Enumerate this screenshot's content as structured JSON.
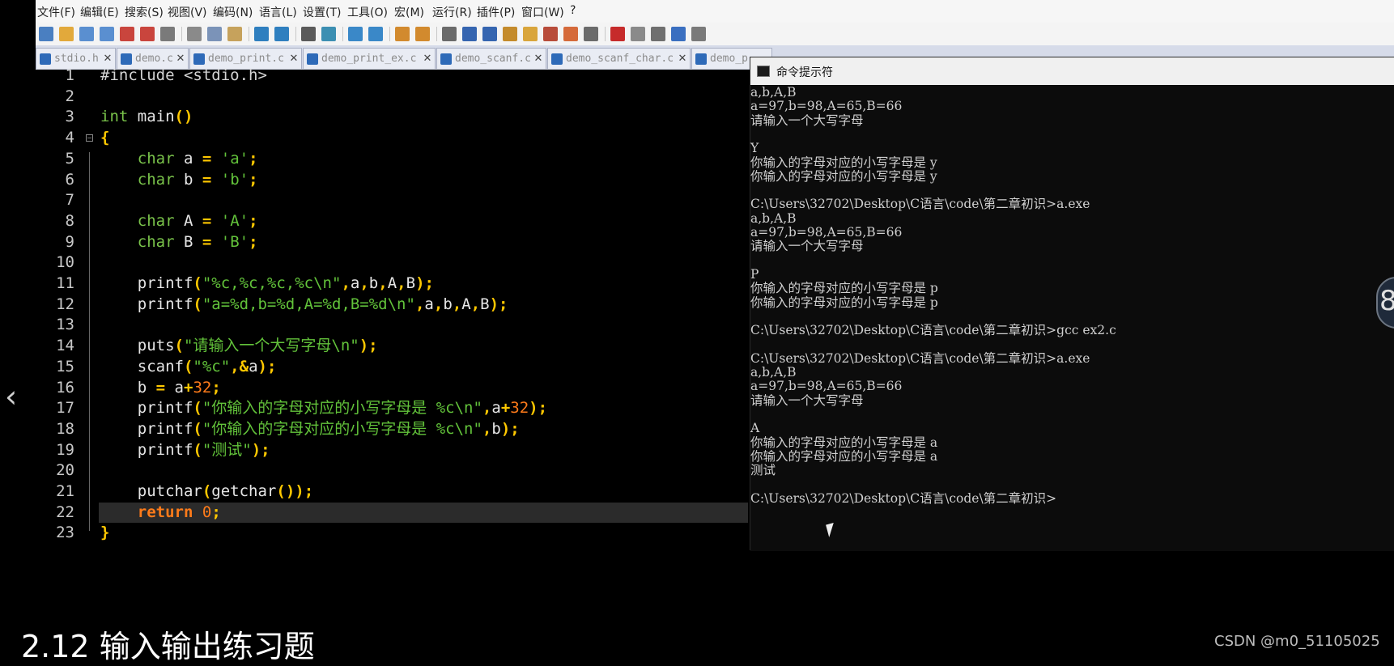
{
  "menubar": {
    "items": [
      "文件(F)",
      "编辑(E)",
      "搜索(S)",
      "视图(V)",
      "编码(N)",
      "语言(L)",
      "设置(T)",
      "工具(O)",
      "宏(M)",
      "运行(R)",
      "插件(P)",
      "窗口(W)",
      "?"
    ]
  },
  "toolbar": {
    "icons": [
      "new-file-icon",
      "open-file-icon",
      "save-icon",
      "save-all-icon",
      "close-icon",
      "close-all-icon",
      "print-icon",
      "cut-icon",
      "copy-icon",
      "paste-icon",
      "undo-icon",
      "redo-icon",
      "find-icon",
      "replace-icon",
      "zoom-in-icon",
      "zoom-out-icon",
      "sync-vertical-icon",
      "sync-horizontal-icon",
      "word-wrap-icon",
      "show-all-chars-icon",
      "indent-guide-icon",
      "document-map-icon",
      "function-list-icon",
      "doc-switcher-icon",
      "folder-workspace-icon",
      "monitoring-icon",
      "record-macro-icon",
      "stop-macro-icon",
      "play-macro-icon",
      "run-macro-multiple-icon",
      "save-macro-icon"
    ]
  },
  "tabs": [
    {
      "label": "stdio.h",
      "icon": "file-icon"
    },
    {
      "label": "demo.c",
      "icon": "file-icon"
    },
    {
      "label": "demo_print.c",
      "icon": "file-icon"
    },
    {
      "label": "demo_print_ex.c",
      "icon": "file-icon"
    },
    {
      "label": "demo_scanf.c",
      "icon": "file-icon"
    },
    {
      "label": "demo_scanf_char.c",
      "icon": "file-icon"
    },
    {
      "label": "demo_p",
      "icon": "file-icon"
    }
  ],
  "editor": {
    "line_numbers": [
      "1",
      "2",
      "3",
      "4",
      "5",
      "6",
      "7",
      "8",
      "9",
      "10",
      "11",
      "12",
      "13",
      "14",
      "15",
      "16",
      "17",
      "18",
      "19",
      "20",
      "21",
      "22",
      "23"
    ],
    "fold_glyph": "−",
    "lines": [
      [
        {
          "t": "#include <stdio.h>",
          "c": "pp"
        }
      ],
      [],
      [
        {
          "t": "int",
          "c": "type"
        },
        {
          "t": " main",
          "c": "id"
        },
        {
          "t": "()",
          "c": "op"
        }
      ],
      [
        {
          "t": "{",
          "c": "op"
        }
      ],
      [
        {
          "t": "    ",
          "c": "id"
        },
        {
          "t": "char",
          "c": "type"
        },
        {
          "t": " a ",
          "c": "id"
        },
        {
          "t": "=",
          "c": "op"
        },
        {
          "t": " ",
          "c": "id"
        },
        {
          "t": "'a'",
          "c": "str"
        },
        {
          "t": ";",
          "c": "op"
        }
      ],
      [
        {
          "t": "    ",
          "c": "id"
        },
        {
          "t": "char",
          "c": "type"
        },
        {
          "t": " b ",
          "c": "id"
        },
        {
          "t": "=",
          "c": "op"
        },
        {
          "t": " ",
          "c": "id"
        },
        {
          "t": "'b'",
          "c": "str"
        },
        {
          "t": ";",
          "c": "op"
        }
      ],
      [],
      [
        {
          "t": "    ",
          "c": "id"
        },
        {
          "t": "char",
          "c": "type"
        },
        {
          "t": " A ",
          "c": "id"
        },
        {
          "t": "=",
          "c": "op"
        },
        {
          "t": " ",
          "c": "id"
        },
        {
          "t": "'A'",
          "c": "str"
        },
        {
          "t": ";",
          "c": "op"
        }
      ],
      [
        {
          "t": "    ",
          "c": "id"
        },
        {
          "t": "char",
          "c": "type"
        },
        {
          "t": " B ",
          "c": "id"
        },
        {
          "t": "=",
          "c": "op"
        },
        {
          "t": " ",
          "c": "id"
        },
        {
          "t": "'B'",
          "c": "str"
        },
        {
          "t": ";",
          "c": "op"
        }
      ],
      [],
      [
        {
          "t": "    printf",
          "c": "id"
        },
        {
          "t": "(",
          "c": "op"
        },
        {
          "t": "\"%c,%c,%c,%c\\n\"",
          "c": "str"
        },
        {
          "t": ",",
          "c": "op"
        },
        {
          "t": "a",
          "c": "id"
        },
        {
          "t": ",",
          "c": "op"
        },
        {
          "t": "b",
          "c": "id"
        },
        {
          "t": ",",
          "c": "op"
        },
        {
          "t": "A",
          "c": "id"
        },
        {
          "t": ",",
          "c": "op"
        },
        {
          "t": "B",
          "c": "id"
        },
        {
          "t": ");",
          "c": "op"
        }
      ],
      [
        {
          "t": "    printf",
          "c": "id"
        },
        {
          "t": "(",
          "c": "op"
        },
        {
          "t": "\"a=%d,b=%d,A=%d,B=%d\\n\"",
          "c": "str"
        },
        {
          "t": ",",
          "c": "op"
        },
        {
          "t": "a",
          "c": "id"
        },
        {
          "t": ",",
          "c": "op"
        },
        {
          "t": "b",
          "c": "id"
        },
        {
          "t": ",",
          "c": "op"
        },
        {
          "t": "A",
          "c": "id"
        },
        {
          "t": ",",
          "c": "op"
        },
        {
          "t": "B",
          "c": "id"
        },
        {
          "t": ");",
          "c": "op"
        }
      ],
      [],
      [
        {
          "t": "    puts",
          "c": "id"
        },
        {
          "t": "(",
          "c": "op"
        },
        {
          "t": "\"请输入一个大写字母\\n\"",
          "c": "str"
        },
        {
          "t": ");",
          "c": "op"
        }
      ],
      [
        {
          "t": "    scanf",
          "c": "id"
        },
        {
          "t": "(",
          "c": "op"
        },
        {
          "t": "\"%c\"",
          "c": "str"
        },
        {
          "t": ",&",
          "c": "op"
        },
        {
          "t": "a",
          "c": "id"
        },
        {
          "t": ");",
          "c": "op"
        }
      ],
      [
        {
          "t": "    b ",
          "c": "id"
        },
        {
          "t": "=",
          "c": "op"
        },
        {
          "t": " a",
          "c": "id"
        },
        {
          "t": "+",
          "c": "op"
        },
        {
          "t": "32",
          "c": "num"
        },
        {
          "t": ";",
          "c": "op"
        }
      ],
      [
        {
          "t": "    printf",
          "c": "id"
        },
        {
          "t": "(",
          "c": "op"
        },
        {
          "t": "\"你输入的字母对应的小写字母是 %c\\n\"",
          "c": "str"
        },
        {
          "t": ",",
          "c": "op"
        },
        {
          "t": "a",
          "c": "id"
        },
        {
          "t": "+",
          "c": "op"
        },
        {
          "t": "32",
          "c": "num"
        },
        {
          "t": ");",
          "c": "op"
        }
      ],
      [
        {
          "t": "    printf",
          "c": "id"
        },
        {
          "t": "(",
          "c": "op"
        },
        {
          "t": "\"你输入的字母对应的小写字母是 %c\\n\"",
          "c": "str"
        },
        {
          "t": ",",
          "c": "op"
        },
        {
          "t": "b",
          "c": "id"
        },
        {
          "t": ");",
          "c": "op"
        }
      ],
      [
        {
          "t": "    printf",
          "c": "id"
        },
        {
          "t": "(",
          "c": "op"
        },
        {
          "t": "\"测试\"",
          "c": "str"
        },
        {
          "t": ");",
          "c": "op"
        }
      ],
      [],
      [
        {
          "t": "    putchar",
          "c": "id"
        },
        {
          "t": "(",
          "c": "op"
        },
        {
          "t": "getchar",
          "c": "id"
        },
        {
          "t": "());",
          "c": "op"
        }
      ],
      [
        {
          "t": "    ",
          "c": "id"
        },
        {
          "t": "return",
          "c": "kw"
        },
        {
          "t": " ",
          "c": "id"
        },
        {
          "t": "0",
          "c": "num"
        },
        {
          "t": ";",
          "c": "op"
        }
      ],
      [
        {
          "t": "}",
          "c": "op"
        }
      ]
    ]
  },
  "cmd": {
    "title": "命令提示符",
    "lines": [
      "a,b,A,B",
      "a=97,b=98,A=65,B=66",
      "请输入一个大写字母",
      "",
      "Y",
      "你输入的字母对应的小写字母是 y",
      "你输入的字母对应的小写字母是 y",
      "",
      "C:\\Users\\32702\\Desktop\\C语言\\code\\第二章初识>a.exe",
      "a,b,A,B",
      "a=97,b=98,A=65,B=66",
      "请输入一个大写字母",
      "",
      "P",
      "你输入的字母对应的小写字母是 p",
      "你输入的字母对应的小写字母是 p",
      "",
      "C:\\Users\\32702\\Desktop\\C语言\\code\\第二章初识>gcc ex2.c",
      "",
      "C:\\Users\\32702\\Desktop\\C语言\\code\\第二章初识>a.exe",
      "a,b,A,B",
      "a=97,b=98,A=65,B=66",
      "请输入一个大写字母",
      "",
      "A",
      "你输入的字母对应的小写字母是 a",
      "你输入的字母对应的小写字母是 a",
      "测试",
      "",
      "C:\\Users\\32702\\Desktop\\C语言\\code\\第二章初识>"
    ]
  },
  "nav": {
    "prev_glyph": "‹"
  },
  "overlay": {
    "caption": "2.12 输入输出练习题",
    "watermark": "CSDN @m0_51105025",
    "badge_digit": "8"
  },
  "colors": {
    "code_type": "#79c24a",
    "code_keyword": "#ff7b1a",
    "code_operator": "#ffc800",
    "code_string": "#62c23a",
    "code_number": "#ff7b1a",
    "cmd_text": "#d0d0d0"
  }
}
